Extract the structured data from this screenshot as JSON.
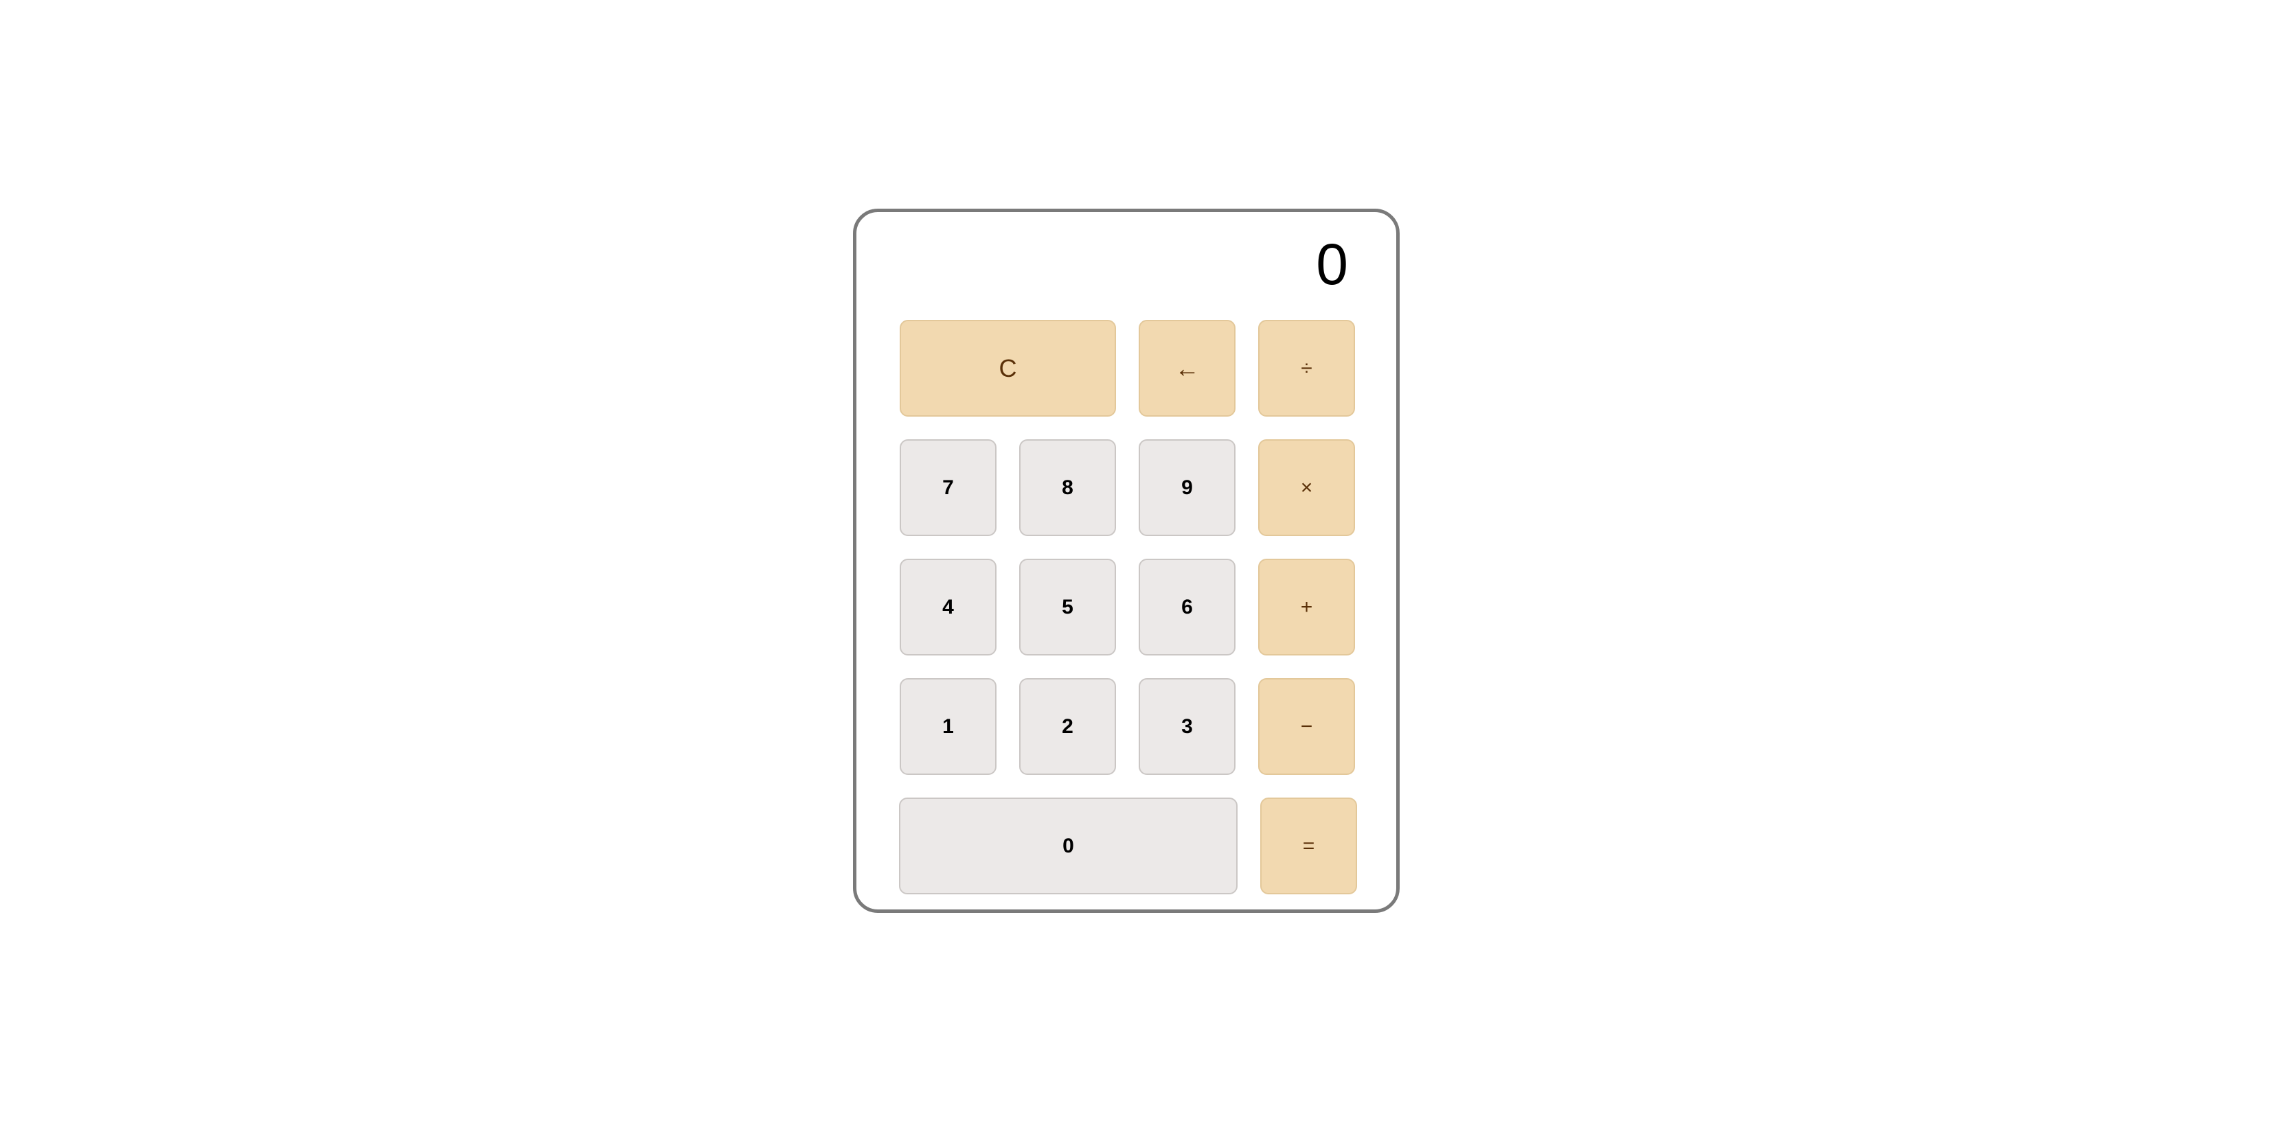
{
  "display": {
    "value": "0"
  },
  "keys": {
    "clear": "C",
    "backspace": "←",
    "divide": "÷",
    "multiply": "×",
    "add": "+",
    "subtract": "−",
    "equals": "=",
    "d7": "7",
    "d8": "8",
    "d9": "9",
    "d4": "4",
    "d5": "5",
    "d6": "6",
    "d1": "1",
    "d2": "2",
    "d3": "3",
    "d0": "0"
  },
  "colors": {
    "digit_bg": "#ece9e8",
    "operator_bg": "#f2d9b0",
    "operator_text": "#5a3008",
    "frame_border": "#7a7a7a"
  }
}
